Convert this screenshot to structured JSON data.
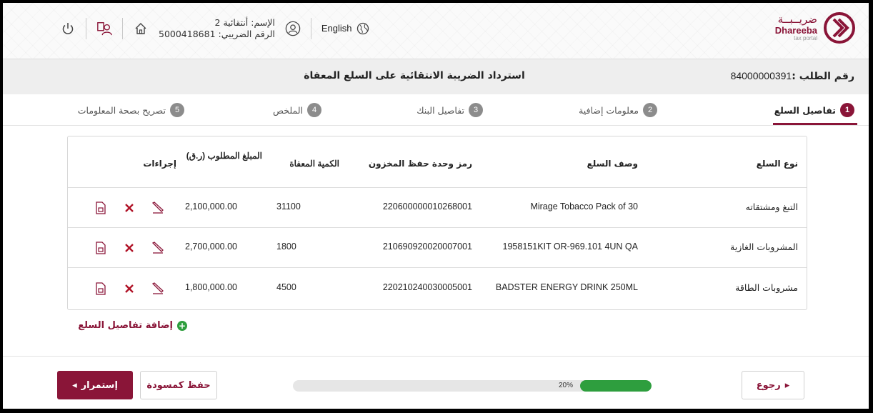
{
  "header": {
    "logo_ar": "ضريــبــة",
    "logo_en": "Dhareeba",
    "logo_sub": "tax portal",
    "lang_label": "English",
    "user_name": "الإسم: أنتقائية 2",
    "tax_number": "الرقم الضريبي: 5000418681",
    "icons": [
      "power-icon",
      "users-icon",
      "home-icon",
      "user-icon",
      "globe-icon"
    ]
  },
  "titlebar": {
    "request_label": "رقم الطلب :",
    "request_number": "84000000391",
    "page_title": "استرداد الضريبة الانتقائية على السلع المعفاة"
  },
  "steps": [
    {
      "num": "1",
      "label": "تفاصيل السلع",
      "active": true
    },
    {
      "num": "2",
      "label": "معلومات إضافية",
      "active": false
    },
    {
      "num": "3",
      "label": "تفاصيل البنك",
      "active": false
    },
    {
      "num": "4",
      "label": "الملخص",
      "active": false
    },
    {
      "num": "5",
      "label": "تصريح بصحة المعلومات",
      "active": false
    }
  ],
  "table": {
    "headers": {
      "type": "نوع السلع",
      "desc": "وصف السلع",
      "sku": "رمز وحدة حفظ المخزون",
      "qty": "الكمية المعفاة",
      "amount": "المبلغ المطلوب (ر.ق)",
      "actions": "إجراءات"
    },
    "rows": [
      {
        "type": "التبغ ومشتقاته",
        "desc": "Mirage Tobacco Pack of 30",
        "sku": "220600000010268001",
        "qty": "31100",
        "amount": "2,100,000.00"
      },
      {
        "type": "المشروبات الغازية",
        "desc": "1958151KIT OR-969.101 4UN QA",
        "sku": "210690920020007001",
        "qty": "1800",
        "amount": "2,700,000.00"
      },
      {
        "type": "مشروبات الطاقة",
        "desc": "BADSTER ENERGY DRINK 250ML",
        "sku": "220210240030005001",
        "qty": "4500",
        "amount": "1,800,000.00"
      }
    ]
  },
  "add_link": "إضافة تفاصيل السلع",
  "footer": {
    "back": "رجوع",
    "continue": "إستمرار",
    "draft": "حفظ كمسودة",
    "progress_label": "20%",
    "progress_value": 0.2
  },
  "colors": {
    "brand": "#8a1538",
    "success": "#2e9e3e"
  }
}
